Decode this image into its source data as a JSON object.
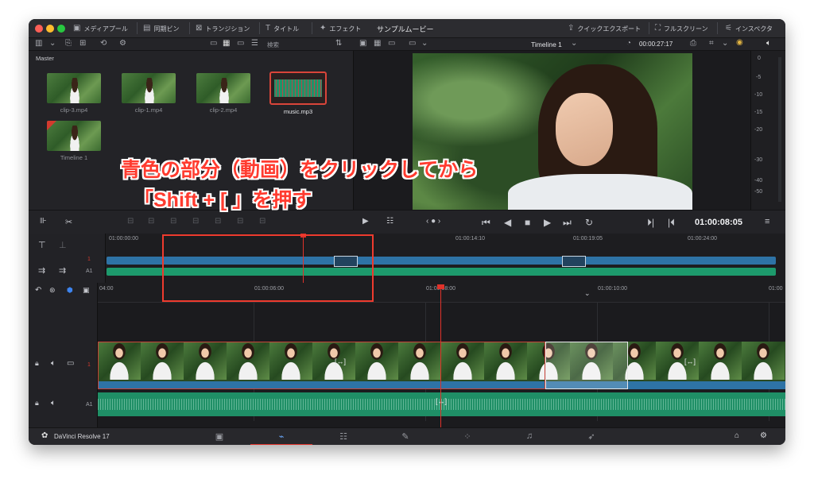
{
  "titlebar": {
    "media_pool": "メディアプール",
    "sync_bin": "同期ビン",
    "transition": "トランジション",
    "title": "タイトル",
    "effects": "エフェクト",
    "project": "サンプルムービー",
    "quick_export": "クイックエクスポート",
    "fullscreen": "フルスクリーン",
    "inspector": "インスペクタ"
  },
  "mediapool": {
    "search": "検索",
    "bin": "Master",
    "clips": [
      {
        "name": "clip-3.mp4"
      },
      {
        "name": "clip-1.mp4"
      },
      {
        "name": "clip-2.mp4"
      },
      {
        "name": "music.mp3"
      },
      {
        "name": "Timeline 1"
      }
    ]
  },
  "viewer": {
    "timeline_name": "Timeline 1",
    "duration": "00:00:27:17",
    "current_timecode": "01:00:08:05"
  },
  "meter_scale": [
    "0",
    "-5",
    "-10",
    "-15",
    "-20",
    "-30",
    "-40",
    "-50"
  ],
  "mini_timeline": {
    "timecodes": [
      "01:00:00:00",
      "01:00:14:10",
      "01:00:19:05",
      "01:00:24:00"
    ],
    "track_v": "1",
    "track_a": "A1"
  },
  "main_timeline": {
    "timecodes": [
      "04:00",
      "01:00:06:00",
      "01:00:08:00",
      "01:00:10:00",
      "01:00"
    ],
    "video_track": "1",
    "audio_track": "A1"
  },
  "annotation": {
    "line1": "青色の部分（動画）をクリックしてから",
    "line2": "「Shift + [ 」を押す",
    "color": "#ff3b2f"
  },
  "bottombar": {
    "app_name": "DaVinci Resolve 17"
  }
}
